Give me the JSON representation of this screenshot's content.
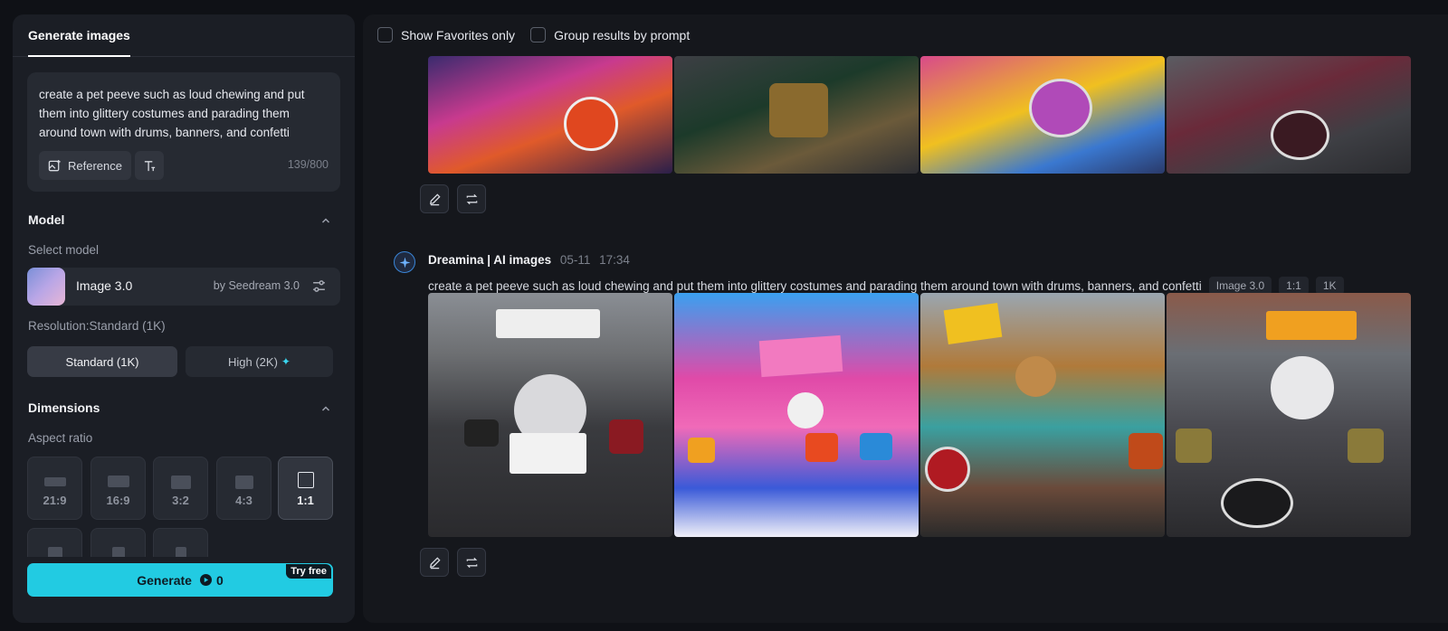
{
  "left_panel": {
    "tab_label": "Generate images",
    "prompt": {
      "text": "create a pet peeve such as loud chewing and put them into glittery costumes and parading them around town with drums, banners, and confetti",
      "reference_label": "Reference",
      "char_count": "139/800"
    },
    "model": {
      "section_title": "Model",
      "select_label": "Select model",
      "name": "Image 3.0",
      "by": "by Seedream 3.0"
    },
    "resolution": {
      "label": "Resolution:Standard (1K)",
      "standard_label": "Standard (1K)",
      "high_label": "High (2K)"
    },
    "dimensions": {
      "section_title": "Dimensions",
      "aspect_label": "Aspect ratio",
      "ratios": [
        "21:9",
        "16:9",
        "3:2",
        "4:3",
        "1:1"
      ],
      "selected": "1:1"
    },
    "generate": {
      "label": "Generate",
      "cost": "0",
      "badge": "Try free"
    }
  },
  "right_panel": {
    "filters": {
      "favorites_label": "Show Favorites only",
      "group_label": "Group results by prompt"
    },
    "message": {
      "author": "Dreamina | AI images",
      "date": "05-11",
      "time": "17:34",
      "prompt": "create a pet peeve such as loud chewing and put them into glittery costumes and parading them around town with drums, banners, and confetti",
      "tags": [
        "Image 3.0",
        "1:1",
        "1K"
      ]
    }
  },
  "colors": {
    "accent": "#22cbe2",
    "panel_bg": "#1b1e25",
    "page_bg": "#0f1116"
  }
}
